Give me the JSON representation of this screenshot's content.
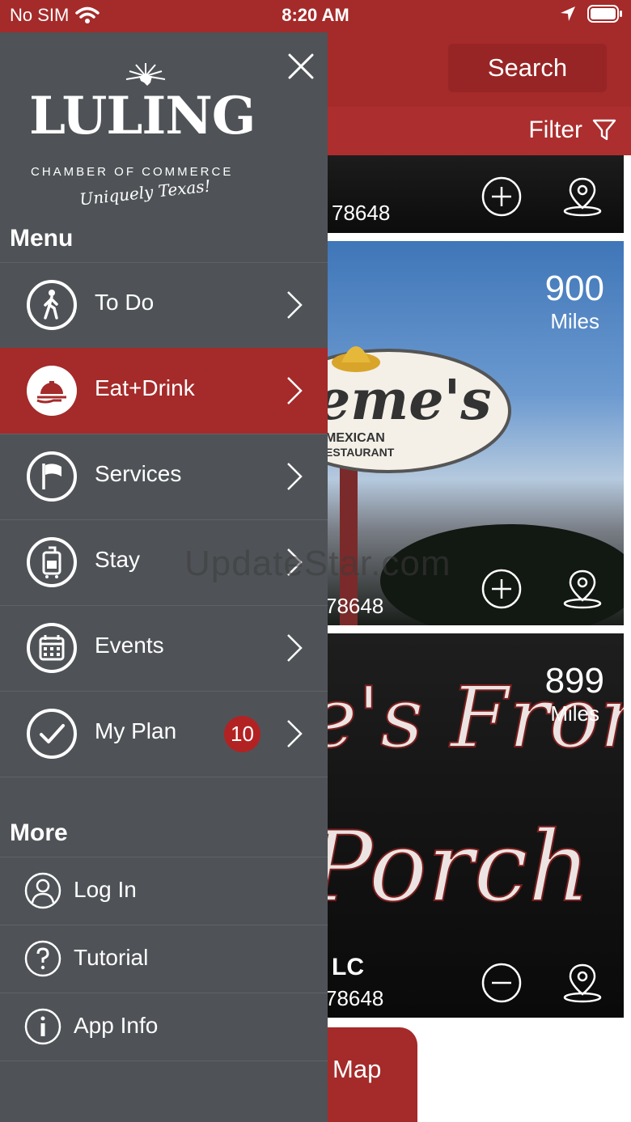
{
  "status_bar": {
    "carrier": "No SIM",
    "time": "8:20 AM"
  },
  "header": {
    "search_label": "Search",
    "filter_label": "Filter"
  },
  "cards": [
    {
      "zip": "78648"
    },
    {
      "zip": "78648",
      "miles": "900",
      "miles_unit": "Miles",
      "sign_top": "eme's",
      "sign_sub1": "MEXICAN",
      "sign_sub2": "ESTAURANT"
    },
    {
      "zip": "78648",
      "name_fragment": "LC",
      "miles": "899",
      "miles_unit": "Miles",
      "sign_top": "e's Fron",
      "sign_bottom": "Porch"
    }
  ],
  "map_button": {
    "label": "w Map"
  },
  "drawer": {
    "logo": {
      "title": "LULING",
      "subtitle": "CHAMBER OF COMMERCE",
      "tagline": "Uniquely Texas!"
    },
    "menu_title": "Menu",
    "menu_items": [
      {
        "label": "To Do",
        "icon": "walking-person-icon"
      },
      {
        "label": "Eat+Drink",
        "icon": "food-tray-icon"
      },
      {
        "label": "Services",
        "icon": "flag-icon"
      },
      {
        "label": "Stay",
        "icon": "luggage-icon"
      },
      {
        "label": "Events",
        "icon": "calendar-icon"
      },
      {
        "label": "My Plan",
        "icon": "checkmark-icon",
        "badge": "10"
      }
    ],
    "more_title": "More",
    "more_items": [
      {
        "label": "Log In",
        "icon": "user-icon"
      },
      {
        "label": "Tutorial",
        "icon": "question-icon"
      },
      {
        "label": "App Info",
        "icon": "info-icon"
      }
    ]
  },
  "watermark": "UpdateStar.com",
  "colors": {
    "brand_red": "#a52a2a",
    "drawer_bg": "#4f5357"
  }
}
